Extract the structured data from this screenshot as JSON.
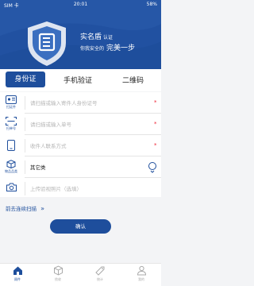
{
  "status_bar": {
    "carrier": "SIM 卡",
    "time": "20:01",
    "battery": "58%"
  },
  "brand": {
    "name": "实名盾",
    "name_suffix": "认证",
    "slogan_prefix": "你我安全的",
    "slogan_main": "完美一步"
  },
  "tabs": [
    {
      "label": "身份证",
      "active": true
    },
    {
      "label": "手机验证",
      "active": false
    },
    {
      "label": "二维码",
      "active": false
    }
  ],
  "form": {
    "id_row": {
      "icon_label": "扫证件",
      "placeholder": "请扫描或输入寄件人身份证号",
      "required": "*"
    },
    "waybill_row": {
      "icon_label": "扫单号",
      "placeholder": "请扫描或输入单号",
      "required": "*"
    },
    "contact_row": {
      "placeholder": "收件人联系方式",
      "required": "*"
    },
    "category_row": {
      "icon_label": "物品品类",
      "value": "其它类"
    },
    "photo_row": {
      "placeholder": "上传验视照片（选填）"
    }
  },
  "continue_scan": {
    "label": "前去连续扫描",
    "arrow": "»"
  },
  "confirm_button": {
    "label": "确认"
  },
  "bottom_nav": [
    {
      "label": "顾件",
      "icon": "home-icon",
      "active": true
    },
    {
      "label": "揽收",
      "icon": "package-icon",
      "active": false
    },
    {
      "label": "统计",
      "icon": "chart-icon",
      "active": false
    },
    {
      "label": "我的",
      "icon": "person-icon",
      "active": false
    }
  ],
  "colors": {
    "primary": "#1e4e9c",
    "required": "#e22233",
    "placeholder": "#b5b5b5"
  }
}
